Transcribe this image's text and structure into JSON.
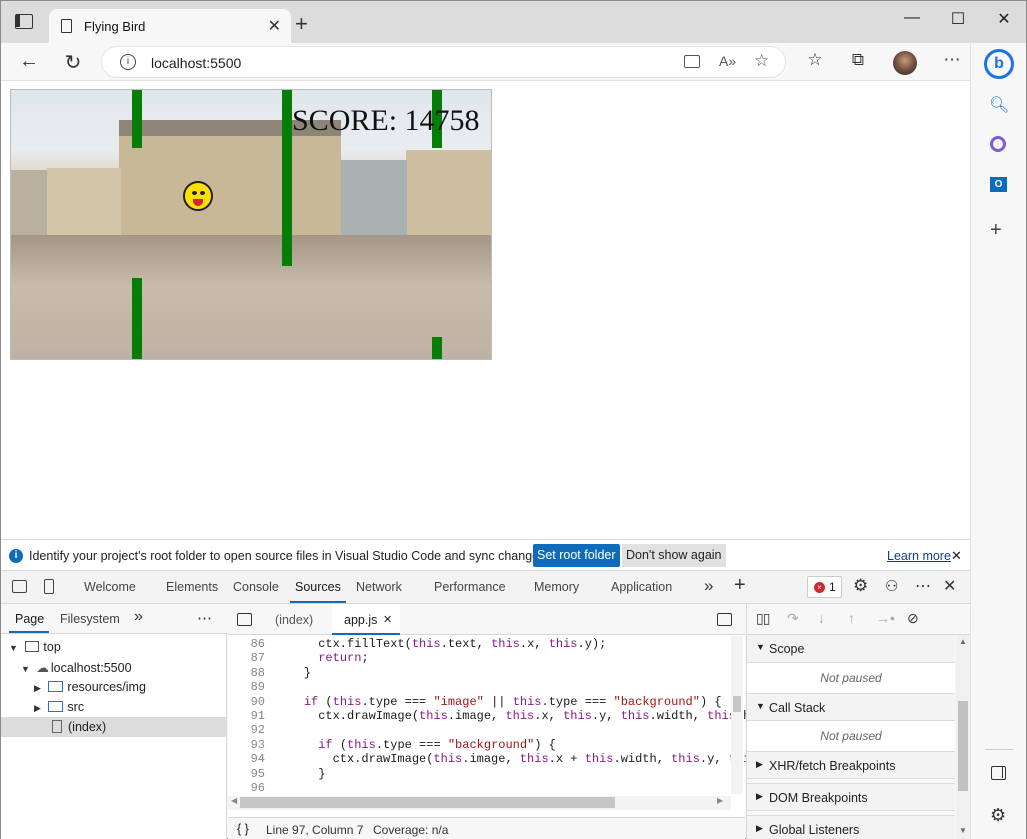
{
  "tab": {
    "title": "Flying Bird",
    "close": "✕"
  },
  "window_controls": {
    "minimize": "—",
    "maximize": "☐",
    "close": "✕"
  },
  "address": {
    "url": "localhost:5500"
  },
  "game": {
    "score_text": "SCORE: 14758",
    "pipe_color": "#067d06"
  },
  "infobar": {
    "message": "Identify your project's root folder to open source files in Visual Studio Code and sync changes.",
    "set_root": "Set root folder",
    "dont_show": "Don't show again",
    "learn_more": "Learn more",
    "close": "✕"
  },
  "devtools": {
    "tabs": [
      "Welcome",
      "Elements",
      "Console",
      "Sources",
      "Network",
      "Performance",
      "Memory",
      "Application"
    ],
    "active_tab": "Sources",
    "more": "»",
    "add": "+",
    "error_count": "1",
    "close": "✕",
    "menu": "⋯"
  },
  "navigator": {
    "tabs": [
      "Page",
      "Filesystem"
    ],
    "more": "»",
    "menu": "⋯",
    "tree": [
      {
        "label": "top"
      },
      {
        "label": "localhost:5500"
      },
      {
        "label": "resources/img"
      },
      {
        "label": "src"
      },
      {
        "label": "(index)"
      }
    ]
  },
  "editor": {
    "tabs": [
      "(index)",
      "app.js"
    ],
    "tab_close": "✕",
    "lines": [
      {
        "n": "86",
        "code": "      ctx.fillText(this.text, this.x, this.y);"
      },
      {
        "n": "87",
        "code": "      return;"
      },
      {
        "n": "88",
        "code": "    }"
      },
      {
        "n": "89",
        "code": ""
      },
      {
        "n": "90",
        "code": "    if (this.type === \"image\" || this.type === \"background\") {"
      },
      {
        "n": "91",
        "code": "      ctx.drawImage(this.image, this.x, this.y, this.width, this.heig"
      },
      {
        "n": "92",
        "code": ""
      },
      {
        "n": "93",
        "code": "      if (this.type === \"background\") {"
      },
      {
        "n": "94",
        "code": "        ctx.drawImage(this.image, this.x + this.width, this.y, this.w"
      },
      {
        "n": "95",
        "code": "      }"
      },
      {
        "n": "96",
        "code": ""
      }
    ],
    "status": {
      "braces": "{ }",
      "position": "Line 97, Column 7",
      "coverage": "Coverage: n/a"
    }
  },
  "debugger": {
    "sections": [
      {
        "label": "Scope",
        "expanded": true,
        "body": "Not paused"
      },
      {
        "label": "Call Stack",
        "expanded": true,
        "body": "Not paused"
      },
      {
        "label": "XHR/fetch Breakpoints",
        "expanded": false
      },
      {
        "label": "DOM Breakpoints",
        "expanded": false
      },
      {
        "label": "Global Listeners",
        "expanded": false
      }
    ]
  }
}
